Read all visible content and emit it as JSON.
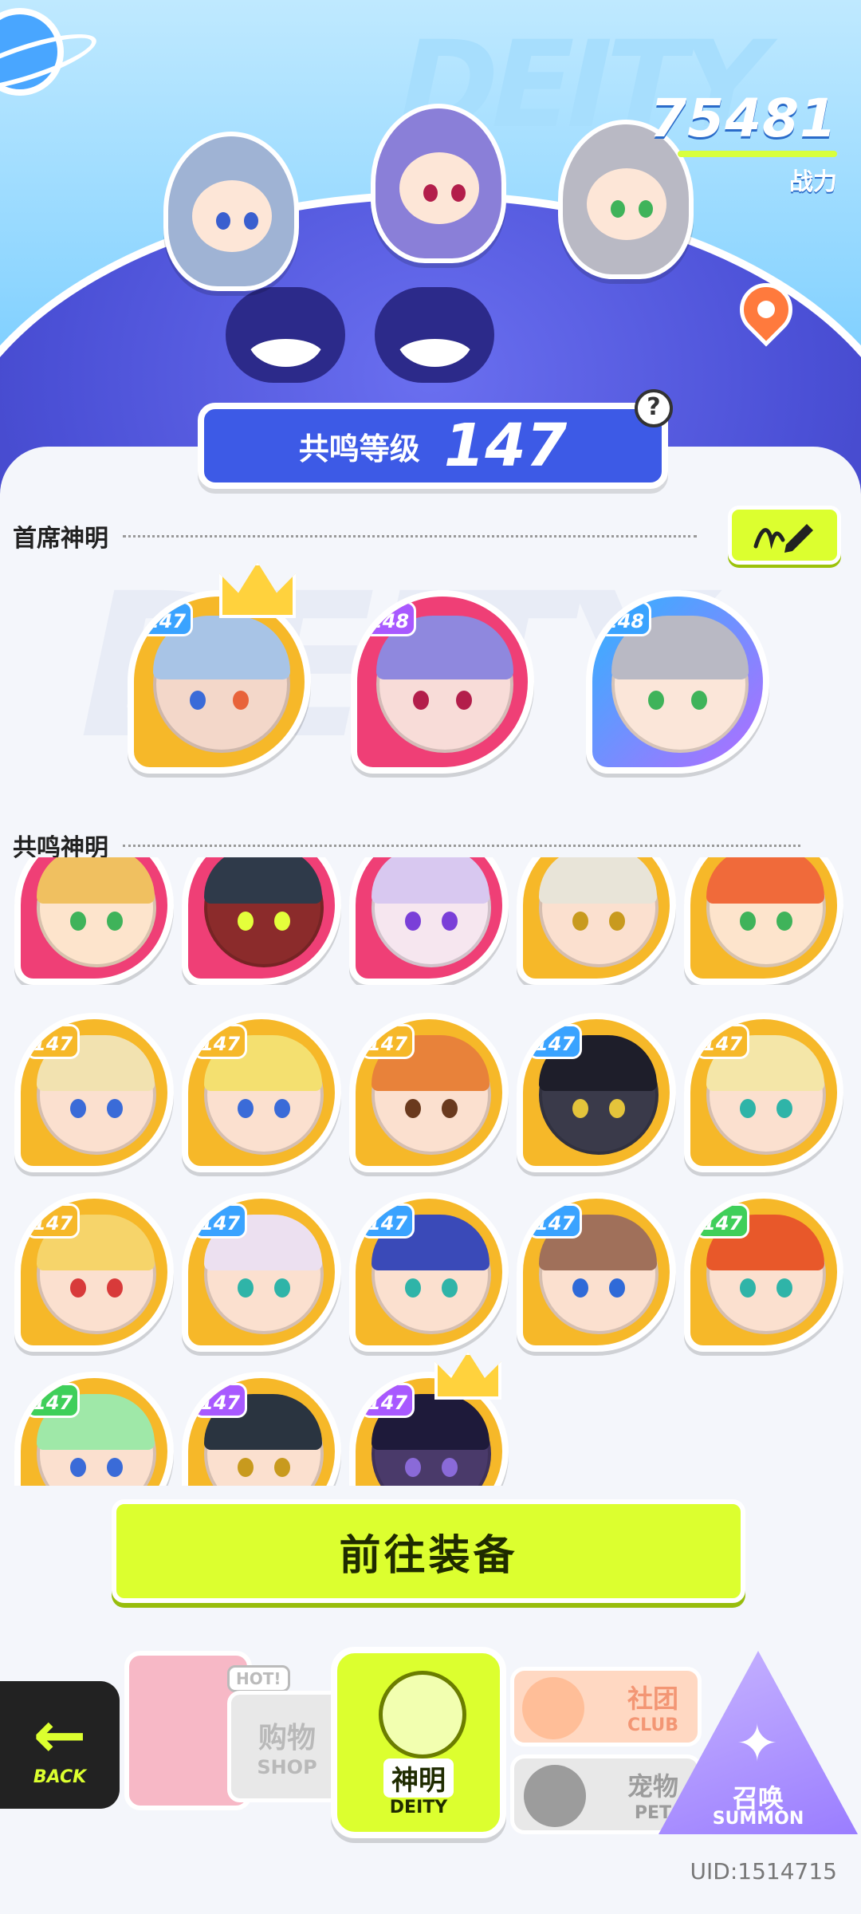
{
  "hero": {
    "watermark": "DEITY",
    "power_value": "75481",
    "power_label": "战力",
    "resonance_label": "共鸣等级",
    "resonance_value": "147",
    "help_symbol": "?"
  },
  "sections": {
    "featured_title": "首席神明",
    "resonance_title": "共鸣神明"
  },
  "featured": [
    {
      "level": "147",
      "frame": "gold",
      "crown": true
    },
    {
      "level": "148",
      "frame": "pink",
      "crown": false
    },
    {
      "level": "148",
      "frame": "blue",
      "crown": false
    }
  ],
  "deities_row1": [
    {
      "level": "",
      "frame": "pink"
    },
    {
      "level": "",
      "frame": "pink"
    },
    {
      "level": "",
      "frame": "pink"
    },
    {
      "level": "",
      "frame": "gold"
    },
    {
      "level": "",
      "frame": "gold"
    }
  ],
  "deities": [
    {
      "level": "147",
      "badge": "y"
    },
    {
      "level": "147",
      "badge": "y"
    },
    {
      "level": "147",
      "badge": "y"
    },
    {
      "level": "147",
      "badge": "b"
    },
    {
      "level": "147",
      "badge": "y"
    },
    {
      "level": "147",
      "badge": "y"
    },
    {
      "level": "147",
      "badge": "b"
    },
    {
      "level": "147",
      "badge": "b"
    },
    {
      "level": "147",
      "badge": "b"
    },
    {
      "level": "147",
      "badge": "g"
    },
    {
      "level": "147",
      "badge": "g"
    },
    {
      "level": "147",
      "badge": "p"
    },
    {
      "level": "147",
      "badge": "p"
    }
  ],
  "cta_label": "前往装备",
  "nav": {
    "back": "BACK",
    "shop_hot": "HOT!",
    "shop_cn": "购物",
    "shop_en": "SHOP",
    "deity_cn": "神明",
    "deity_en": "DEITY",
    "club_cn": "社团",
    "club_en": "CLUB",
    "pet_cn": "宠物",
    "pet_en": "PET",
    "summon_cn": "召唤",
    "summon_en": "SUMMON"
  },
  "uid": "UID:1514715"
}
